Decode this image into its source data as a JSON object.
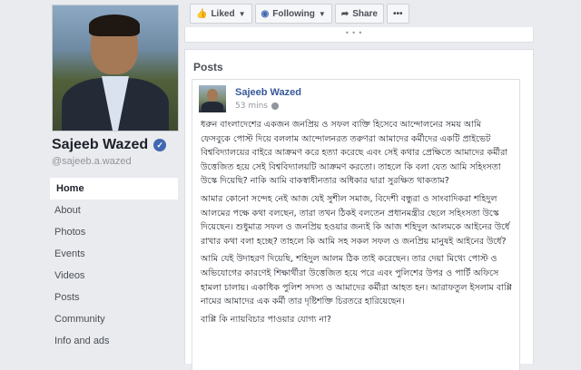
{
  "profile": {
    "name": "Sajeeb Wazed",
    "username": "@sajeeb.a.wazed"
  },
  "nav": {
    "items": [
      {
        "label": "Home"
      },
      {
        "label": "About"
      },
      {
        "label": "Photos"
      },
      {
        "label": "Events"
      },
      {
        "label": "Videos"
      },
      {
        "label": "Posts"
      },
      {
        "label": "Community"
      },
      {
        "label": "Info and ads"
      }
    ]
  },
  "actions": {
    "liked_label": "Liked",
    "following_label": "Following",
    "share_label": "Share",
    "more_label": "•••"
  },
  "posts": {
    "header": "Posts",
    "post": {
      "author": "Sajeeb Wazed",
      "time": "53 mins",
      "paragraphs": [
        "ধরুন বাংলাদেশের একজন জনপ্রিয় ও সফল ব্যক্তি হিসেবে আন্দোলনের সময় আমি ফেসবুকে পোস্ট দিয়ে বললাম আন্দোলনরত তরুণরা আমাদের কর্মীদের একটি প্রাইভেট বিশ্ববিদ্যালয়ের বাইরে আক্রমণ করে হত্যা করেছে এবং সেই কথার প্রেক্ষিতে আমাদের কর্মীরা উত্তেজিত হয়ে সেই বিশ্ববিদ্যালয়টি আক্রমণ করতো। তাহলে কি বলা যেত আমি সহিংসতা উস্কে দিয়েছি? নাকি আমি বাকস্বাধীনতার অধিকার দ্বারা সুরক্ষিত থাকতাম?",
        "আমার কোনো সন্দেহ নেই আজ যেই সুশীল সমাজ, বিদেশী বন্ধুরা ও সাংবাদিকরা শহিদুল আলমের পক্ষে কথা বলছেন, তারা তখন ঠিকই বলতেন প্রধানমন্ত্রীর ছেলে সহিংসতা উস্কে দিয়েছেন। শুধুমাত্র সফল ও জনপ্রিয় হওয়ার জন্যই কি আজ শহিদুল আলমকে আইনের উর্ধে রাখার কথা বলা হচ্ছে? তাহলে কি আমি সহ সকল সফল ও জনপ্রিয় মানুষই আইনের উর্ধে?",
        "আমি যেই উদাহরণ দিয়েছি, শহিদুল আলম ঠিক তাই করেছেন। তার দেয়া মিথ্যে পোস্ট ও অভিযোগের কারণেই শিক্ষার্থীরা উত্তেজিত হয়ে পরে এবং পুলিশের উপর ও পার্টি অফিসে হামলা চালায়। একাধিক পুলিশ সদস্য ও আমাদের কর্মীরা আহত হন। আরাফতুল ইসলাম বাপ্পি নামের আমাদের এক কর্মী তার দৃষ্টিশক্তি চিরতরে হারিয়েছেন।",
        "বাপ্পি কি ন্যায়বিচার পাওয়ার যোগ্য না?"
      ]
    }
  }
}
